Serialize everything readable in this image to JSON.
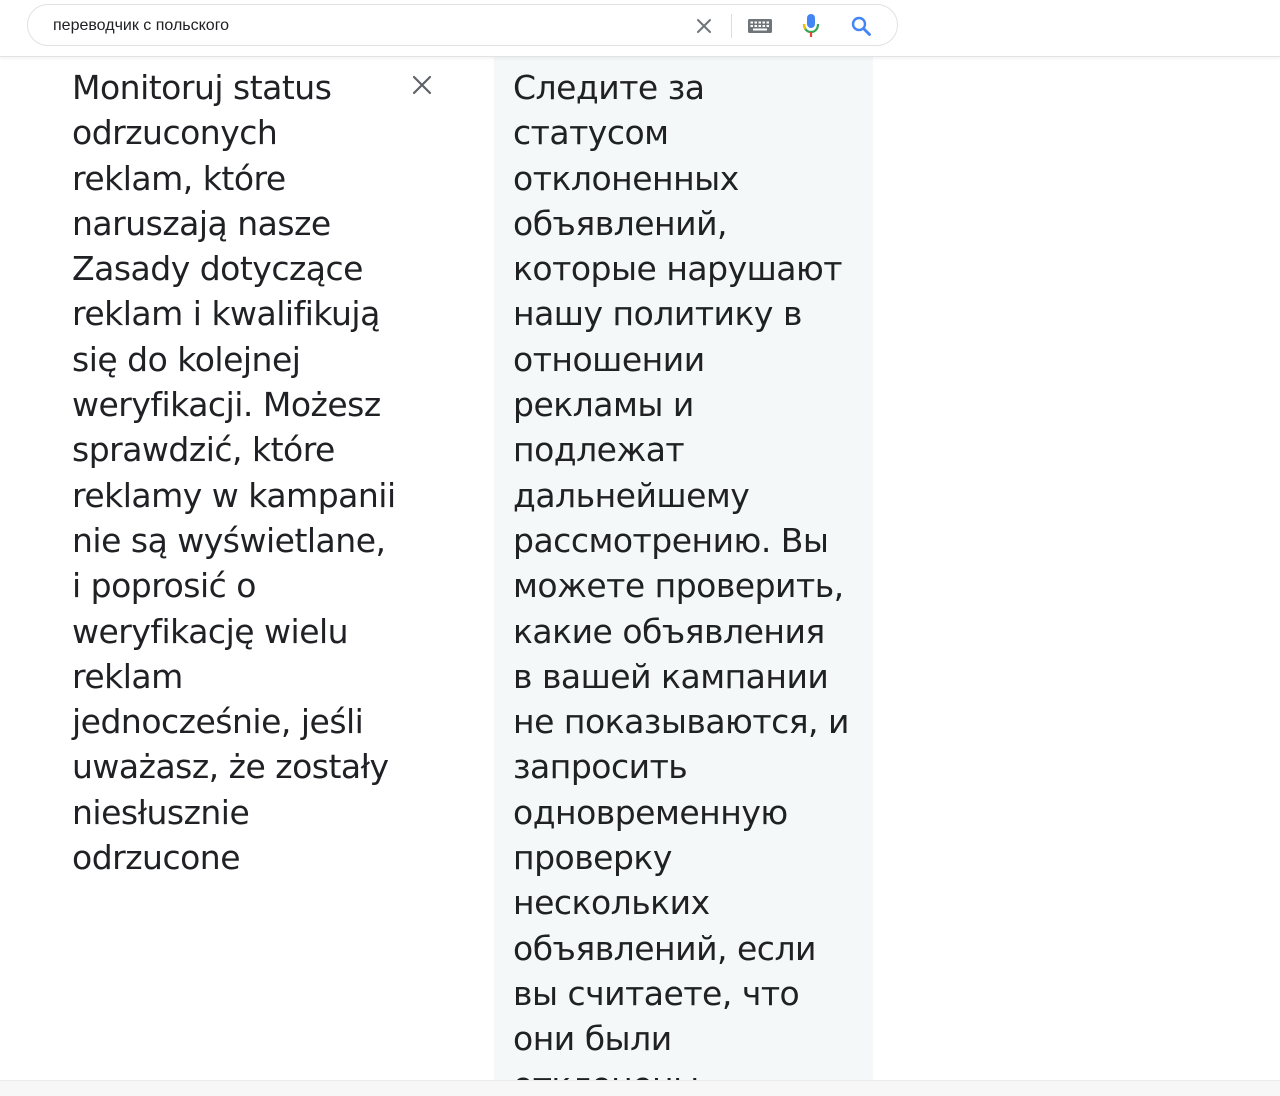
{
  "search": {
    "value": "переводчик с польского",
    "icons": [
      "clear-icon",
      "keyboard-icon",
      "microphone-icon",
      "search-icon"
    ]
  },
  "translation": {
    "source_text": "Monitoruj status odrzuconych reklam, które naruszają nasze Zasady dotyczące reklam i kwalifikują się do kolejnej weryfikacji. Możesz sprawdzić, które reklamy w kampanii nie są wyświetlane, i poprosić o weryfikację wielu reklam jednocześnie, jeśli uważasz, że zostały niesłusznie odrzucone",
    "target_text": "Следите за статусом отклоненных объявлений, которые нарушают нашу политику в отношении рекламы и подлежат дальнейшему рассмотрению. Вы можете проверить, какие объявления в вашей кампании не показываются, и запросить одновременную проверку нескольких объявлений, если вы считаете, что они были отклонены"
  },
  "colors": {
    "mic_blue": "#4285f4",
    "mic_red": "#ea4335",
    "mic_green": "#34a853",
    "mic_yellow": "#fbbc05",
    "search_blue": "#4285f4",
    "target_bg": "#f5f8f8"
  }
}
